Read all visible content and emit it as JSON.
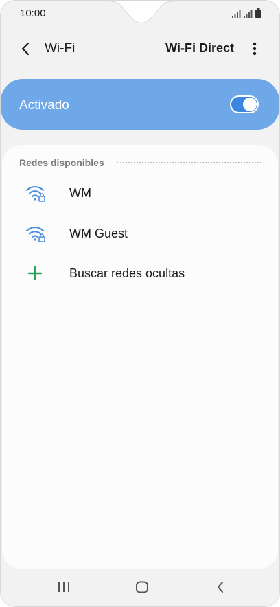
{
  "status_bar": {
    "time": "10:00",
    "icons": [
      "signal-icon",
      "signal-icon",
      "battery-icon"
    ]
  },
  "app_bar": {
    "title": "Wi-Fi",
    "wifi_direct_label": "Wi-Fi Direct",
    "back_icon": "back-icon",
    "more_icon": "more-options-icon"
  },
  "master_switch": {
    "label": "Activado",
    "state": "on"
  },
  "networks": {
    "section_title": "Redes disponibles",
    "items": [
      {
        "label": "WM",
        "icon": "wifi-lock-icon"
      },
      {
        "label": "WM Guest",
        "icon": "wifi-lock-icon"
      },
      {
        "label": "Buscar redes ocultas",
        "icon": "plus-icon"
      }
    ]
  },
  "nav_bar": {
    "icons": [
      "recent-apps-icon",
      "home-icon",
      "back-icon"
    ]
  },
  "colors": {
    "accent": "#3d86e0",
    "master_card": "#6fa8e8",
    "wifi_icon": "#4a8fe0",
    "add_icon": "#27a35a"
  }
}
